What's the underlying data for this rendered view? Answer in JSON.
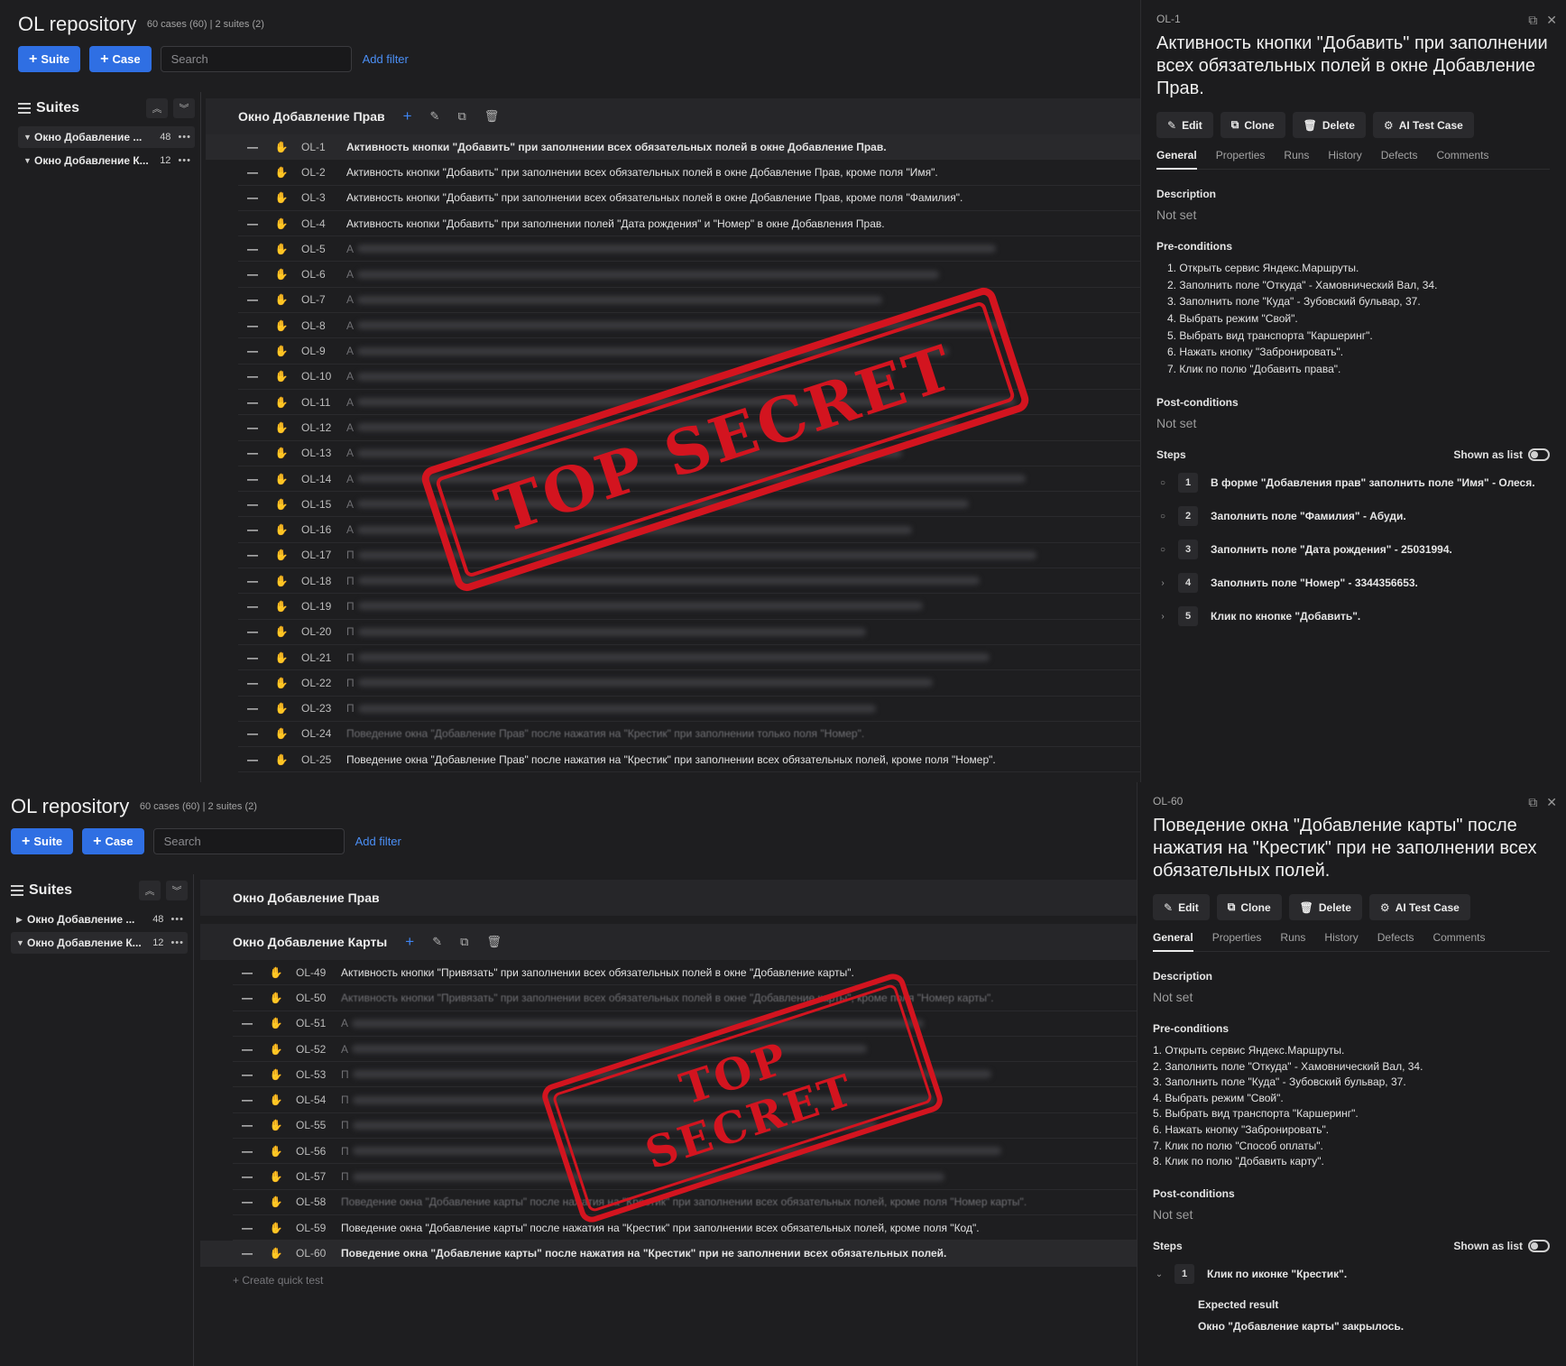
{
  "top": {
    "repo_title": "OL repository",
    "repo_meta": "60 cases (60) | 2 suites (2)",
    "buttons": {
      "suite": "Suite",
      "case": "Case"
    },
    "search_placeholder": "Search",
    "add_filter": "Add filter",
    "suites_title": "Suites",
    "suites": [
      {
        "name": "Окно Добавление ...",
        "count": "48",
        "expanded": true,
        "active": true
      },
      {
        "name": "Окно Добавление К...",
        "count": "12",
        "expanded": true,
        "active": false
      }
    ],
    "group_title": "Окно Добавление Прав",
    "rows": [
      {
        "id": "OL-1",
        "title": "Активность кнопки \"Добавить\" при заполнении всех обязательных полей в окне Добавление Прав.",
        "highlight": true
      },
      {
        "id": "OL-2",
        "title": "Активность кнопки \"Добавить\" при заполнении всех обязательных полей в окне Добавление Прав, кроме поля \"Имя\"."
      },
      {
        "id": "OL-3",
        "title": "Активность кнопки \"Добавить\" при заполнении всех обязательных полей в окне Добавление Прав, кроме поля \"Фамилия\"."
      },
      {
        "id": "OL-4",
        "title": "Активность кнопки \"Добавить\" при заполнении полей \"Дата рождения\" и \"Номер\" в окне Добавления Прав."
      },
      {
        "id": "OL-5",
        "title": "А",
        "blurred": true
      },
      {
        "id": "OL-6",
        "title": "А",
        "blurred": true
      },
      {
        "id": "OL-7",
        "title": "А",
        "blurred": true
      },
      {
        "id": "OL-8",
        "title": "А",
        "blurred": true
      },
      {
        "id": "OL-9",
        "title": "А",
        "blurred": true
      },
      {
        "id": "OL-10",
        "title": "А",
        "blurred": true
      },
      {
        "id": "OL-11",
        "title": "А",
        "blurred": true
      },
      {
        "id": "OL-12",
        "title": "А",
        "blurred": true
      },
      {
        "id": "OL-13",
        "title": "А",
        "blurred": true
      },
      {
        "id": "OL-14",
        "title": "А",
        "blurred": true
      },
      {
        "id": "OL-15",
        "title": "А",
        "blurred": true
      },
      {
        "id": "OL-16",
        "title": "А",
        "blurred": true
      },
      {
        "id": "OL-17",
        "title": "П",
        "blurred": true
      },
      {
        "id": "OL-18",
        "title": "П",
        "blurred": true
      },
      {
        "id": "OL-19",
        "title": "П",
        "blurred": true
      },
      {
        "id": "OL-20",
        "title": "П",
        "blurred": true
      },
      {
        "id": "OL-21",
        "title": "П",
        "blurred": true
      },
      {
        "id": "OL-22",
        "title": "П",
        "blurred": true
      },
      {
        "id": "OL-23",
        "title": "П",
        "blurred": true
      },
      {
        "id": "OL-24",
        "title": "Поведение окна \"Добавление Прав\" после нажатия на \"Крестик\" при заполнении только поля \"Номер\".",
        "dim": true
      },
      {
        "id": "OL-25",
        "title": "Поведение окна \"Добавление Прав\" после нажатия на \"Крестик\" при заполнении всех обязательных полей, кроме поля \"Номер\"."
      }
    ],
    "detail": {
      "id": "OL-1",
      "title": "Активность кнопки \"Добавить\" при заполнении всех обязательных полей в окне Добавление Прав.",
      "actions": [
        "Edit",
        "Clone",
        "Delete",
        "AI Test Case"
      ],
      "tabs": [
        "General",
        "Properties",
        "Runs",
        "History",
        "Defects",
        "Comments"
      ],
      "description_label": "Description",
      "description": "Not set",
      "pre_label": "Pre-conditions",
      "pre": [
        "1. Открыть сервис Яндекс.Маршруты.",
        "2. Заполнить поле \"Откуда\" - Хамовнический Вал, 34.",
        "3. Заполнить поле \"Куда\" - Зубовский бульвар, 37.",
        "4. Выбрать режим \"Свой\".",
        "5. Выбрать вид транспорта \"Каршеринг\".",
        "6. Нажать кнопку \"Забронировать\".",
        "7. Клик по полю \"Добавить права\"."
      ],
      "post_label": "Post-conditions",
      "post": "Not set",
      "steps_label": "Steps",
      "shown_as_list": "Shown as list",
      "steps": [
        {
          "n": "1",
          "text": "В форме \"Добавления прав\" заполнить поле \"Имя\" - Олеся.",
          "marker": "○"
        },
        {
          "n": "2",
          "text": "Заполнить поле \"Фамилия\" - Абуди.",
          "marker": "○"
        },
        {
          "n": "3",
          "text": "Заполнить поле \"Дата рождения\" - 25031994.",
          "marker": "○"
        },
        {
          "n": "4",
          "text": "Заполнить поле \"Номер\" - 3344356653.",
          "marker": "›"
        },
        {
          "n": "5",
          "text": "Клик по кнопке \"Добавить\".",
          "marker": "›"
        }
      ]
    },
    "stamp": "TOP SECRET"
  },
  "bottom": {
    "repo_title": "OL repository",
    "repo_meta": "60 cases (60) | 2 suites (2)",
    "buttons": {
      "suite": "Suite",
      "case": "Case"
    },
    "search_placeholder": "Search",
    "add_filter": "Add filter",
    "suites_title": "Suites",
    "suites": [
      {
        "name": "Окно Добавление ...",
        "count": "48",
        "expanded": false,
        "active": false
      },
      {
        "name": "Окно Добавление К...",
        "count": "12",
        "expanded": true,
        "active": true
      }
    ],
    "collapsed_group": "Окно Добавление Прав",
    "group_title": "Окно Добавление Карты",
    "rows": [
      {
        "id": "OL-49",
        "title": "Активность кнопки \"Привязать\" при заполнении всех обязательных полей в окне \"Добавление карты\"."
      },
      {
        "id": "OL-50",
        "title": "Активность кнопки \"Привязать\" при заполнении всех обязательных полей в окне \"Добавление карты\", кроме поля \"Номер карты\".",
        "dim": true
      },
      {
        "id": "OL-51",
        "title": "А",
        "blurred": true
      },
      {
        "id": "OL-52",
        "title": "А",
        "blurred": true
      },
      {
        "id": "OL-53",
        "title": "П",
        "blurred": true
      },
      {
        "id": "OL-54",
        "title": "П",
        "blurred": true
      },
      {
        "id": "OL-55",
        "title": "П",
        "blurred": true
      },
      {
        "id": "OL-56",
        "title": "П",
        "blurred": true
      },
      {
        "id": "OL-57",
        "title": "П",
        "blurred": true
      },
      {
        "id": "OL-58",
        "title": "Поведение окна \"Добавление карты\" после нажатия на \"Крестик\" при заполнении всех обязательных полей, кроме поля \"Номер карты\".",
        "dim": true
      },
      {
        "id": "OL-59",
        "title": "Поведение окна \"Добавление карты\" после нажатия на \"Крестик\" при заполнении всех обязательных полей, кроме поля \"Код\"."
      },
      {
        "id": "OL-60",
        "title": "Поведение окна \"Добавление карты\" после нажатия на \"Крестик\" при не заполнении всех обязательных полей.",
        "highlight": true
      }
    ],
    "create_quick": "+ Create quick test",
    "detail": {
      "id": "OL-60",
      "title": "Поведение окна \"Добавление карты\" после нажатия на \"Крестик\" при не заполнении всех обязательных полей.",
      "actions": [
        "Edit",
        "Clone",
        "Delete",
        "AI Test Case"
      ],
      "tabs": [
        "General",
        "Properties",
        "Runs",
        "History",
        "Defects",
        "Comments"
      ],
      "description_label": "Description",
      "description": "Not set",
      "pre_label": "Pre-conditions",
      "pre": [
        "1. Открыть сервис Яндекс.Маршруты.",
        "2. Заполнить поле \"Откуда\" - Хамовнический Вал, 34.",
        "3. Заполнить поле \"Куда\" - Зубовский бульвар, 37.",
        "4. Выбрать режим \"Свой\".",
        "5. Выбрать вид транспорта \"Каршеринг\".",
        "6. Нажать кнопку \"Забронировать\".",
        "7. Клик по полю \"Способ оплаты\".",
        "8. Клик по полю \"Добавить карту\"."
      ],
      "post_label": "Post-conditions",
      "post": "Not set",
      "steps_label": "Steps",
      "shown_as_list": "Shown as list",
      "steps": [
        {
          "n": "1",
          "text": "Клик по иконке \"Крестик\".",
          "marker": "⌄"
        }
      ],
      "expected_label": "Expected result",
      "expected": "Окно \"Добавление карты\" закрылось."
    },
    "stamp": "TOP SECRET"
  },
  "icons": {
    "hamburger": "hamburger-icon",
    "collapse": "chevrons-up-icon",
    "expand": "chevrons-down-icon",
    "drag": "hand-icon",
    "edit": "pencil-icon",
    "copy": "copy-icon",
    "delete": "trash-icon",
    "close": "close-icon",
    "restore": "restore-window-icon"
  },
  "colors": {
    "accent": "#2f6fe3",
    "link": "#4b8ff5",
    "stamp": "#d3141f"
  }
}
